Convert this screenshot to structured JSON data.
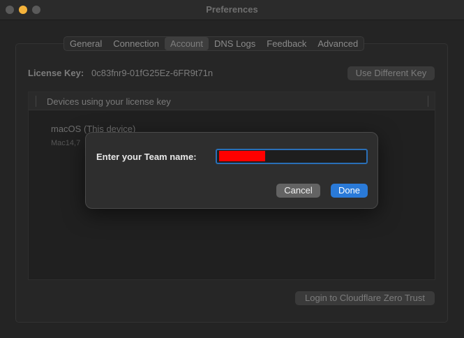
{
  "window": {
    "title": "Preferences"
  },
  "tabs": [
    {
      "label": "General"
    },
    {
      "label": "Connection"
    },
    {
      "label": "Account"
    },
    {
      "label": "DNS Logs"
    },
    {
      "label": "Feedback"
    },
    {
      "label": "Advanced"
    }
  ],
  "selected_tab": "Account",
  "account": {
    "license_label": "License Key:",
    "license_value": "0c83fnr9-01fG25Ez-6FR9t71n",
    "use_different_key_label": "Use Different Key",
    "devices_header": "Devices using your license key",
    "devices": [
      {
        "name": "macOS (This device)",
        "detail": "Mac14,7"
      }
    ],
    "login_button_label": "Login to Cloudflare Zero Trust"
  },
  "dialog": {
    "label": "Enter your Team name:",
    "input_value": "",
    "cancel_label": "Cancel",
    "done_label": "Done"
  },
  "colors": {
    "accent": "#2a7ad8",
    "redaction": "#ff0000",
    "traffic_min": "#f5b33b"
  }
}
